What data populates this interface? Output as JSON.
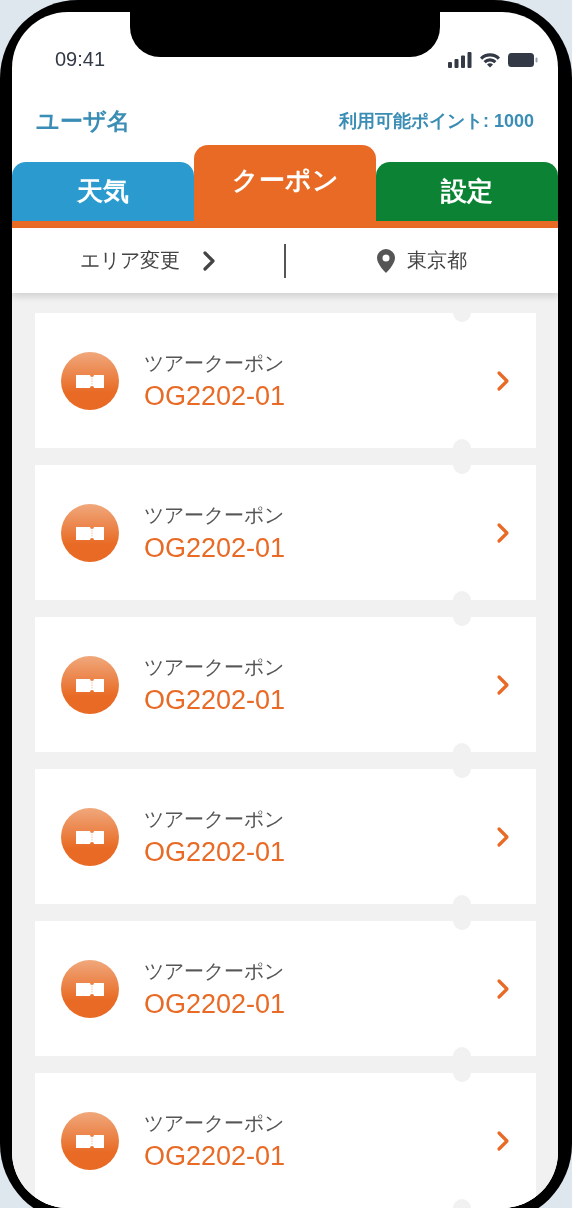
{
  "status_bar": {
    "time": "09:41"
  },
  "header": {
    "user_name": "ユーザ名",
    "points": "利用可能ポイント: 1000"
  },
  "tabs": [
    {
      "label": "天気",
      "selected": false,
      "color": "#2b9bcf"
    },
    {
      "label": "クーポン",
      "selected": true,
      "color": "#e86a24"
    },
    {
      "label": "設定",
      "selected": false,
      "color": "#0b8234"
    }
  ],
  "area_bar": {
    "change_label": "エリア変更",
    "location": "東京都"
  },
  "coupons": [
    {
      "title": "ツアークーポン",
      "code": "OG2202-01"
    },
    {
      "title": "ツアークーポン",
      "code": "OG2202-01"
    },
    {
      "title": "ツアークーポン",
      "code": "OG2202-01"
    },
    {
      "title": "ツアークーポン",
      "code": "OG2202-01"
    },
    {
      "title": "ツアークーポン",
      "code": "OG2202-01"
    },
    {
      "title": "ツアークーポン",
      "code": "OG2202-01"
    }
  ]
}
